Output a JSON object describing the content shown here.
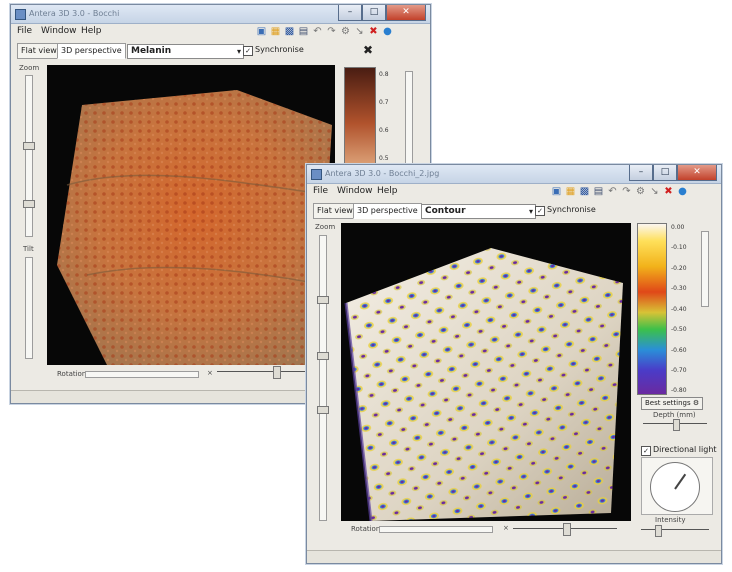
{
  "back_window": {
    "title": "Antera 3D 3.0 - Bocchi",
    "menu": [
      "File",
      "Window",
      "Help"
    ],
    "tabs": [
      "Flat view",
      "3D perspective"
    ],
    "active_tab": 1,
    "mode_select": "Melanin",
    "sync_label": "Synchronise",
    "sync_checked": true,
    "zoom_label": "Zoom",
    "tilt_label": "Tilt",
    "rotation_label": "Rotation",
    "scale_ticks": [
      "0.8",
      "0.7",
      "0.6",
      "0.5"
    ],
    "colors": {
      "scale_top": "#4a1d12",
      "scale_mid": "#b0522c",
      "scale_bottom": "#e9b98e"
    }
  },
  "front_window": {
    "title": "Antera 3D 3.0 - Bocchi_2.jpg",
    "menu": [
      "File",
      "Window",
      "Help"
    ],
    "tabs": [
      "Flat view",
      "3D perspective"
    ],
    "active_tab": 1,
    "mode_select": "Contour",
    "sync_label": "Synchronise",
    "sync_checked": true,
    "zoom_label": "Zoom",
    "rotation_label": "Rotation",
    "scale_ticks": [
      "0.00",
      "-0.10",
      "-0.20",
      "-0.30",
      "-0.40",
      "-0.50",
      "-0.60",
      "-0.70",
      "-0.80"
    ],
    "auto_button": "Best settings",
    "depth_label": "Depth (mm)",
    "light_checkbox": "Directional light",
    "light_checked": true,
    "intensity_label": "Intensity"
  },
  "icons": [
    "select-icon",
    "open-icon",
    "save-icon",
    "export-icon",
    "undo-icon",
    "redo-icon",
    "settings-icon",
    "measure-icon",
    "close-doc-icon",
    "info-icon"
  ]
}
